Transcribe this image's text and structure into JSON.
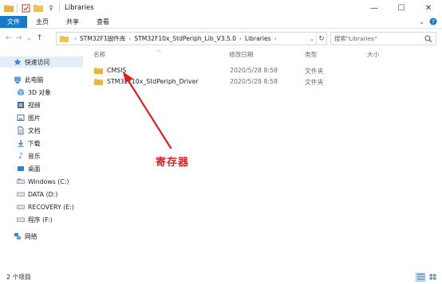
{
  "window": {
    "title": "Libraries",
    "controls": {
      "minimize": "—",
      "maximize": "☐",
      "close": "✕"
    }
  },
  "ribbon": {
    "tabs": [
      {
        "label": "文件",
        "active": true
      },
      {
        "label": "主页"
      },
      {
        "label": "共享"
      },
      {
        "label": "查看"
      }
    ]
  },
  "address": {
    "back": "←",
    "forward": "→",
    "recent": "⌄",
    "up": "↑",
    "breadcrumbs": [
      "STM32F1固件库",
      "STM32F10x_StdPeriph_Lib_V3.5.0",
      "Libraries"
    ],
    "separator": "›",
    "search_placeholder": "搜索\"Libraries\""
  },
  "nav": {
    "items": [
      {
        "label": "快速访问",
        "icon": "star-icon"
      },
      {
        "label": "此电脑",
        "icon": "pc-icon"
      },
      {
        "label": "3D 对象",
        "icon": "cube-icon"
      },
      {
        "label": "视频",
        "icon": "video-icon"
      },
      {
        "label": "图片",
        "icon": "picture-icon"
      },
      {
        "label": "文档",
        "icon": "document-icon"
      },
      {
        "label": "下载",
        "icon": "download-icon"
      },
      {
        "label": "音乐",
        "icon": "music-icon"
      },
      {
        "label": "桌面",
        "icon": "desktop-icon"
      },
      {
        "label": "Windows (C:)",
        "icon": "drive-icon"
      },
      {
        "label": "DATA (D:)",
        "icon": "drive-icon"
      },
      {
        "label": "RECOVERY (E:)",
        "icon": "drive-icon"
      },
      {
        "label": "程序 (F:)",
        "icon": "drive-icon"
      },
      {
        "label": "网络",
        "icon": "network-icon"
      }
    ]
  },
  "columns": {
    "name": "名称",
    "modified": "修改日期",
    "type": "类型",
    "size": "大小"
  },
  "files": [
    {
      "name": "CMSIS",
      "modified": "2020/5/28 8:58",
      "type": "文件夹",
      "size": ""
    },
    {
      "name": "STM32F10x_StdPeriph_Driver",
      "modified": "2020/5/28 8:58",
      "type": "文件夹",
      "size": ""
    }
  ],
  "annotation": {
    "text": "寄存器",
    "color": "#e02020"
  },
  "status": {
    "count": "2 个项目"
  },
  "colors": {
    "accent": "#1979ca",
    "folder": "#f3c24f",
    "selection": "#e5eef8"
  }
}
